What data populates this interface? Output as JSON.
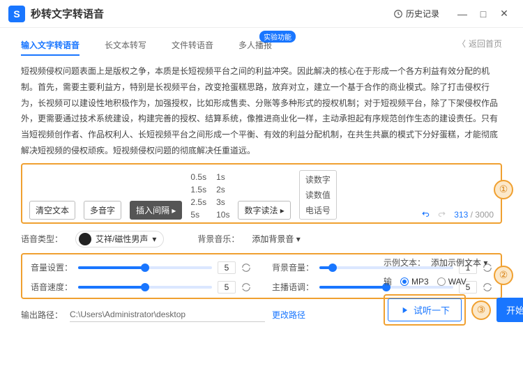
{
  "app": {
    "title": "秒转文字转语音",
    "logo": "S"
  },
  "titlebar": {
    "history": "历史记录",
    "min": "—",
    "max": "□",
    "close": "✕"
  },
  "tabs": {
    "items": [
      "输入文字转语音",
      "长文本转写",
      "文件转语音",
      "多人播报"
    ],
    "badge": "实验功能",
    "back": "返回首页"
  },
  "text": "短视频侵权问题表面上是版权之争，本质是长短视频平台之间的利益冲突。因此解决的核心在于形成一个各方利益有效分配的机制。首先，需要主要利益方，特别是长视频平台，改变抢蛋糕思路，放弃对立，建立一个基于合作的商业模式。除了打击侵权行为，长视频可以建设性地积极作为，加强授权，比如形成售卖、分账等多种形式的授权机制；对于短视频平台，除了下架侵权作品外，更需要通过技术系统建设，构建完善的授权、结算系统，像推进商业化一样，主动承担起有序规范创作生态的建设责任。只有当短视频创作者、作品权利人、长短视频平台之间形成一个平衡、有效的利益分配机制，在共生共赢的模式下分好蛋糕，才能彻底解决短视频的侵权顽疾。短视频侵权问题的彻底解决任重道远。",
  "toolbar": {
    "clear": "清空文本",
    "poly": "多音字",
    "pause": "插入间隔",
    "read": "数字读法",
    "pauses": [
      "0.5s",
      "1s",
      "1.5s",
      "2s",
      "2.5s",
      "3s",
      "5s",
      "10s"
    ],
    "readmodes": [
      "读数字",
      "读数值",
      "电话号"
    ]
  },
  "counter": {
    "cur": "313",
    "max": "3000"
  },
  "voicerow": {
    "voicetype": "语音类型：",
    "voicename": "艾祥/磁性男声",
    "bglabel": "背景音乐：",
    "bgvalue": "添加背景音"
  },
  "sliders": {
    "vol": "音量设置：",
    "volval": "5",
    "bgvol": "背景音量：",
    "bgvolval": "1",
    "speed": "语音速度：",
    "speedval": "5",
    "tone": "主播语调：",
    "toneval": "5"
  },
  "right": {
    "sample": "示例文本：",
    "sampleval": "添加示例文本",
    "fmtlabel": "输",
    "mp3": "MP3",
    "wav": "WAV",
    "listen": "试听一下",
    "start": "开始转换"
  },
  "path": {
    "label": "输出路径：",
    "value": "C:\\Users\\Administrator\\desktop",
    "change": "更改路径"
  },
  "marks": {
    "n1": "①",
    "n2": "②",
    "n3": "③"
  }
}
